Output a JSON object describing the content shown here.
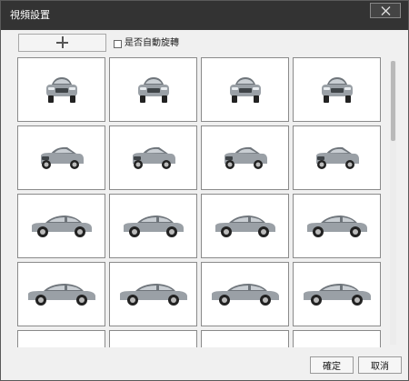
{
  "window": {
    "title": "視頻設置"
  },
  "toolbar": {
    "rotate_label": "是否自動旋轉",
    "rotate_checked": false
  },
  "thumbnails": [
    {
      "view": "front"
    },
    {
      "view": "front"
    },
    {
      "view": "front"
    },
    {
      "view": "front"
    },
    {
      "view": "front-three-quarter"
    },
    {
      "view": "front-three-quarter"
    },
    {
      "view": "front-three-quarter"
    },
    {
      "view": "front-three-quarter"
    },
    {
      "view": "side-front"
    },
    {
      "view": "side-front"
    },
    {
      "view": "side-front"
    },
    {
      "view": "side-front"
    },
    {
      "view": "side"
    },
    {
      "view": "side"
    },
    {
      "view": "side"
    },
    {
      "view": "side"
    },
    {
      "view": "partial"
    },
    {
      "view": "partial"
    },
    {
      "view": "partial"
    },
    {
      "view": "partial"
    }
  ],
  "footer": {
    "ok_label": "確定",
    "cancel_label": "取消"
  },
  "colors": {
    "titlebar": "#333333",
    "dialog_bg": "#f0f0f0",
    "car_body": "#9aa0a6"
  }
}
